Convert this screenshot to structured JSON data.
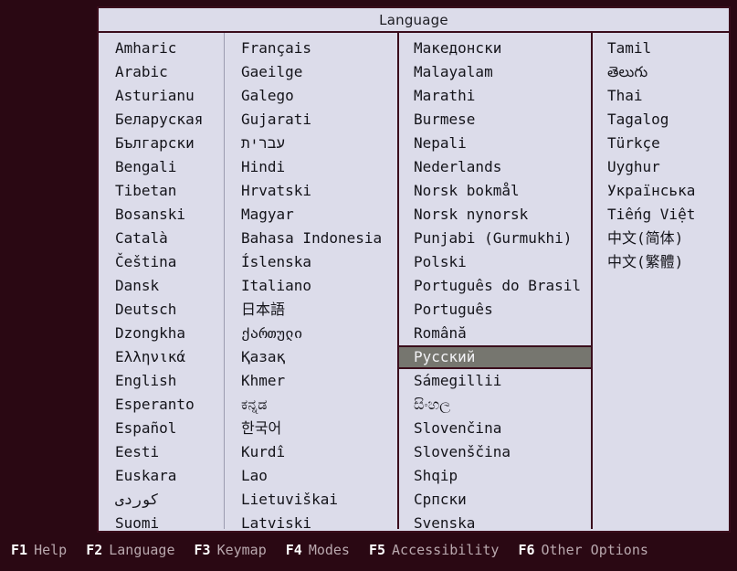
{
  "screen": {
    "background_color": "#2a0813",
    "dialog_bg_color": "#dcdcea",
    "border_color": "#3a0d1c",
    "selection_color": "#76766f"
  },
  "dialog": {
    "title": "Language"
  },
  "language_list": {
    "selected": "Русский",
    "columns": [
      {
        "index": 0,
        "items": [
          "Amharic",
          "Arabic",
          "Asturianu",
          "Беларуская",
          "Български",
          "Bengali",
          "Tibetan",
          "Bosanski",
          "Català",
          "Čeština",
          "Dansk",
          "Deutsch",
          "Dzongkha",
          "Ελληνικά",
          "English",
          "Esperanto",
          "Español",
          "Eesti",
          "Euskara",
          "کوردی",
          "Suomi"
        ]
      },
      {
        "index": 1,
        "items": [
          "Français",
          "Gaeilge",
          "Galego",
          "Gujarati",
          "עברית",
          "Hindi",
          "Hrvatski",
          "Magyar",
          "Bahasa Indonesia",
          "Íslenska",
          "Italiano",
          "日本語",
          "ქართული",
          "Қазақ",
          "Khmer",
          "ಕನ್ನಡ",
          "한국어",
          "Kurdî",
          "Lao",
          "Lietuviškai",
          "Latviski"
        ]
      },
      {
        "index": 2,
        "items": [
          "Македонски",
          "Malayalam",
          "Marathi",
          "Burmese",
          "Nepali",
          "Nederlands",
          "Norsk bokmål",
          "Norsk nynorsk",
          "Punjabi (Gurmukhi)",
          "Polski",
          "Português do Brasil",
          "Português",
          "Română",
          "Русский",
          "Sámegillii",
          "සිංහල",
          "Slovenčina",
          "Slovenščina",
          "Shqip",
          "Српски",
          "Svenska"
        ]
      },
      {
        "index": 3,
        "items": [
          "Tamil",
          "తెలుగు",
          "Thai",
          "Tagalog",
          "Türkçe",
          "Uyghur",
          "Українська",
          "Tiếng Việt",
          "中文(简体)",
          "中文(繁體)"
        ]
      }
    ]
  },
  "function_keys": [
    {
      "key": "F1",
      "label": "Help"
    },
    {
      "key": "F2",
      "label": "Language"
    },
    {
      "key": "F3",
      "label": "Keymap"
    },
    {
      "key": "F4",
      "label": "Modes"
    },
    {
      "key": "F5",
      "label": "Accessibility"
    },
    {
      "key": "F6",
      "label": "Other Options"
    }
  ]
}
